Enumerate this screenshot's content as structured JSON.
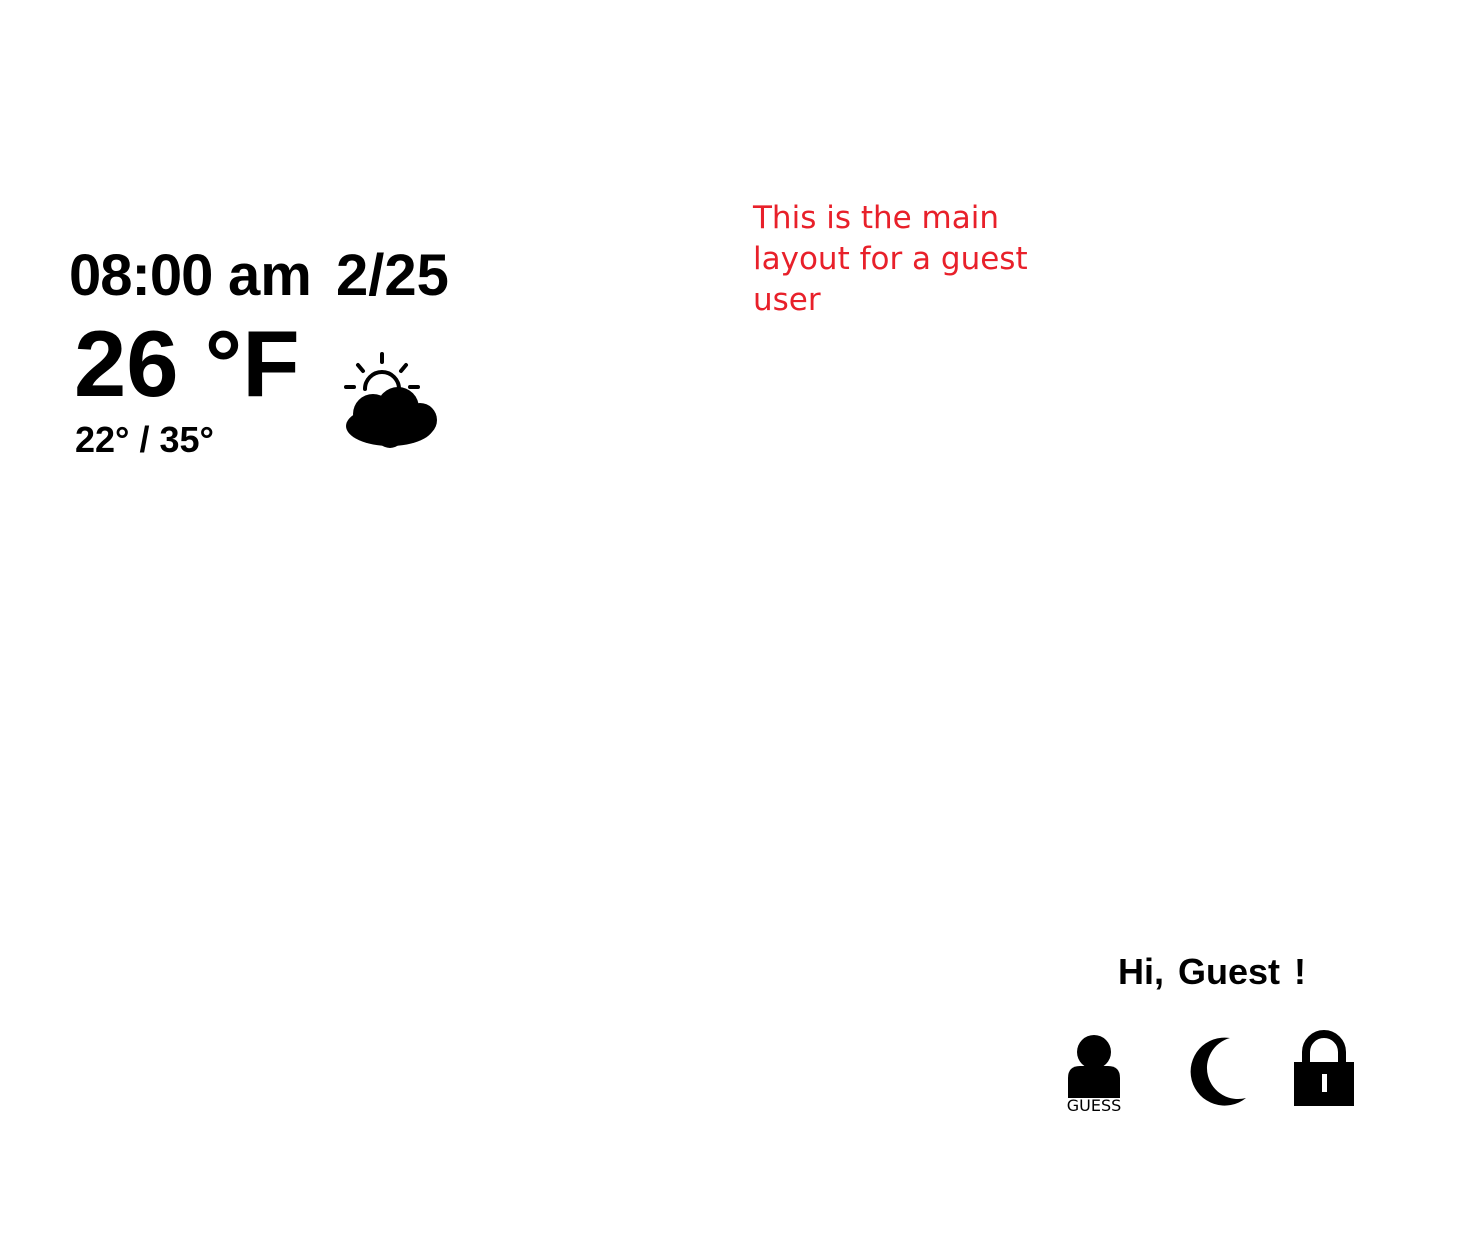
{
  "clock": {
    "time": "08:00",
    "period": "am",
    "date": "2/25"
  },
  "weather": {
    "temperature": "26 °F",
    "range": "22° / 35°",
    "condition_icon": "partly-cloudy-icon"
  },
  "note": {
    "text": "This is the main layout for a guest user",
    "color": "#e8202a"
  },
  "user_panel": {
    "greeting": "Hi, Guest !",
    "user_label": "GUESS",
    "user_icon": "user-icon",
    "sleep_icon": "moon-icon",
    "lock_icon": "lock-icon"
  }
}
